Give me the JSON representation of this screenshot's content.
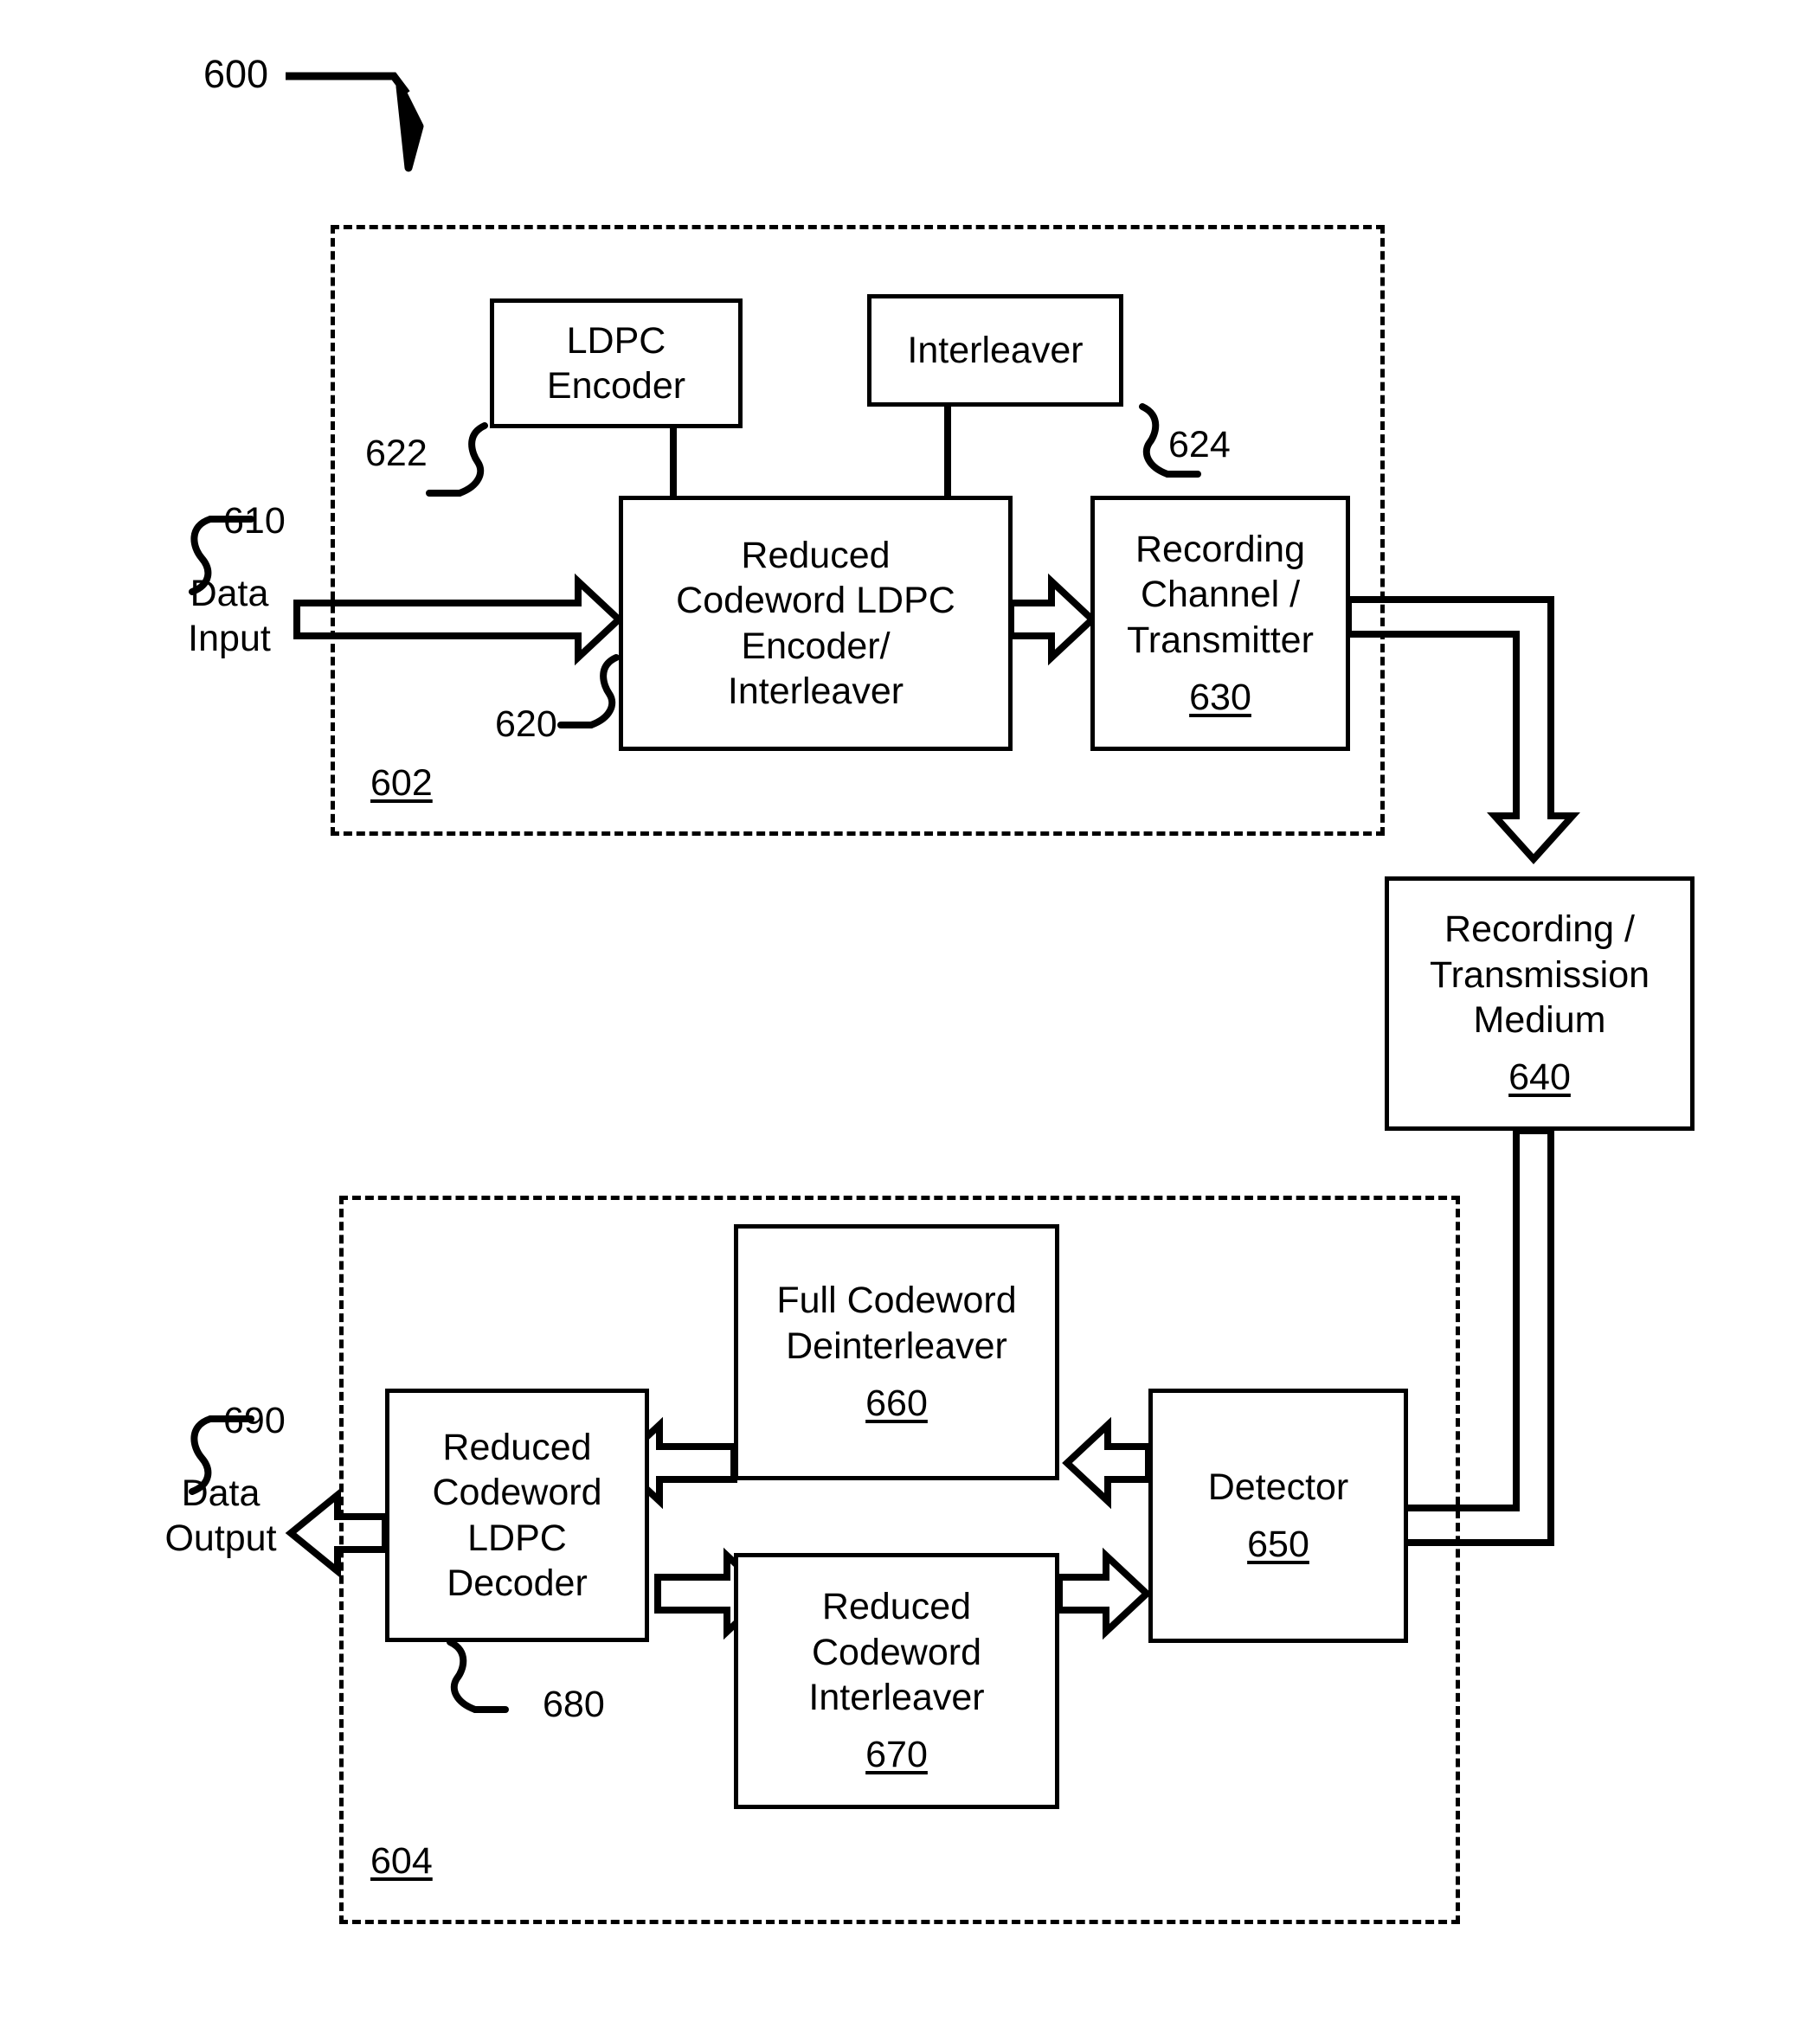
{
  "figure": {
    "number": "600",
    "type": "block-diagram",
    "title_ref": "600"
  },
  "groups": [
    {
      "id": "602",
      "label": "602",
      "role": "transmit-side-dashed-group"
    },
    {
      "id": "604",
      "label": "604",
      "role": "receive-side-dashed-group"
    }
  ],
  "blocks": [
    {
      "id": "622",
      "name": "ldpc-encoder",
      "lines": [
        "LDPC",
        "Encoder"
      ],
      "ref": "622",
      "ref_inside": false,
      "ref_underlined": false
    },
    {
      "id": "624",
      "name": "interleaver",
      "lines": [
        "Interleaver"
      ],
      "ref": "624",
      "ref_inside": false,
      "ref_underlined": false
    },
    {
      "id": "620",
      "name": "reduced-codeword-ldpc-encoder-interleaver",
      "lines": [
        "Reduced",
        "Codeword LDPC",
        "Encoder/",
        "Interleaver"
      ],
      "ref": "620",
      "ref_inside": false,
      "ref_underlined": false
    },
    {
      "id": "630",
      "name": "recording-channel-transmitter",
      "lines": [
        "Recording",
        "Channel /",
        "Transmitter"
      ],
      "ref": "630",
      "ref_inside": true,
      "ref_underlined": true
    },
    {
      "id": "640",
      "name": "recording-transmission-medium",
      "lines": [
        "Recording /",
        "Transmission",
        "Medium"
      ],
      "ref": "640",
      "ref_inside": true,
      "ref_underlined": true
    },
    {
      "id": "660",
      "name": "full-codeword-deinterleaver",
      "lines": [
        "Full Codeword",
        "Deinterleaver"
      ],
      "ref": "660",
      "ref_inside": true,
      "ref_underlined": true
    },
    {
      "id": "650",
      "name": "detector",
      "lines": [
        "Detector"
      ],
      "ref": "650",
      "ref_inside": true,
      "ref_underlined": true
    },
    {
      "id": "680",
      "name": "reduced-codeword-ldpc-decoder",
      "lines": [
        "Reduced",
        "Codeword",
        "LDPC",
        "Decoder"
      ],
      "ref": "680",
      "ref_inside": false,
      "ref_underlined": false
    },
    {
      "id": "670",
      "name": "reduced-codeword-interleaver",
      "lines": [
        "Reduced",
        "Codeword",
        "Interleaver"
      ],
      "ref": "670",
      "ref_inside": true,
      "ref_underlined": true
    }
  ],
  "io": {
    "data_input": {
      "lines": [
        "Data",
        "Input"
      ],
      "ref": "610"
    },
    "data_output": {
      "lines": [
        "Data",
        "Output"
      ],
      "ref": "690"
    }
  },
  "colors": {
    "stroke": "#000000",
    "fill": "#ffffff",
    "text": "#000000"
  }
}
